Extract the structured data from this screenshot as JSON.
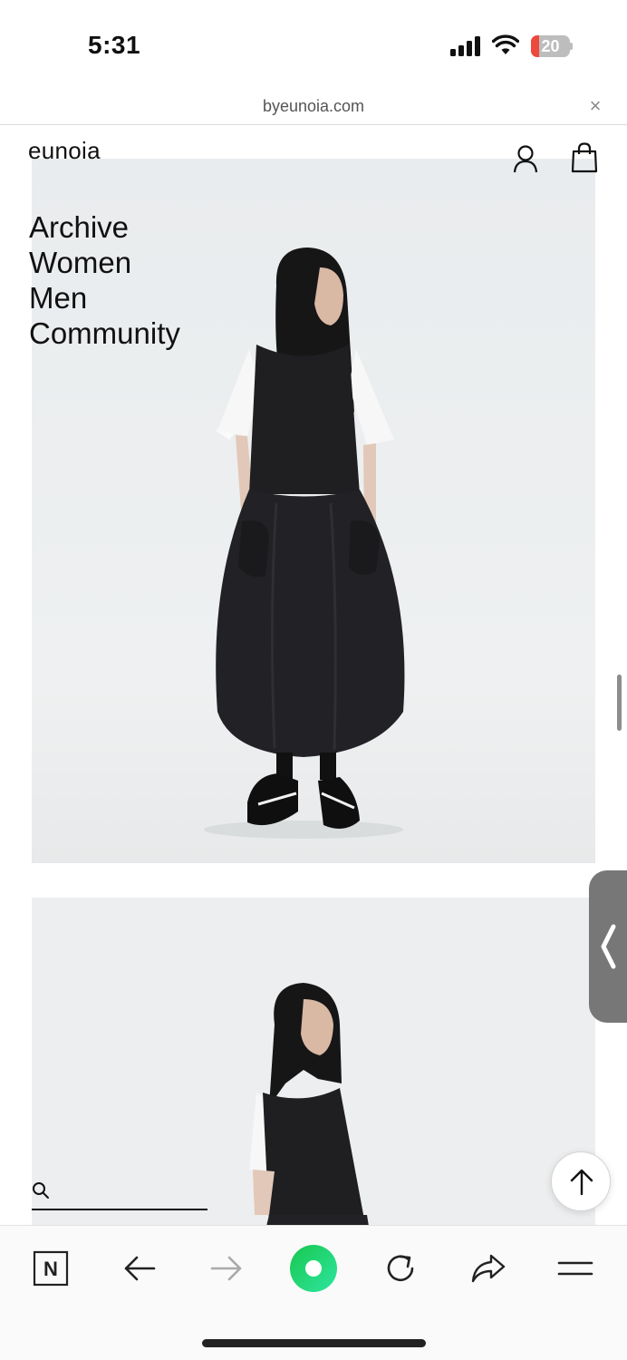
{
  "status_bar": {
    "time": "5:31",
    "battery_level": "20"
  },
  "browser": {
    "url": "byeunoia.com",
    "close_symbol": "×"
  },
  "site": {
    "logo": "eunoia",
    "nav": [
      "Archive",
      "Women",
      "Men",
      "Community"
    ]
  },
  "toolbar": {
    "n_label": "N"
  },
  "colors": {
    "accent": "#1ed760",
    "battery_low": "#ec4a3c"
  }
}
